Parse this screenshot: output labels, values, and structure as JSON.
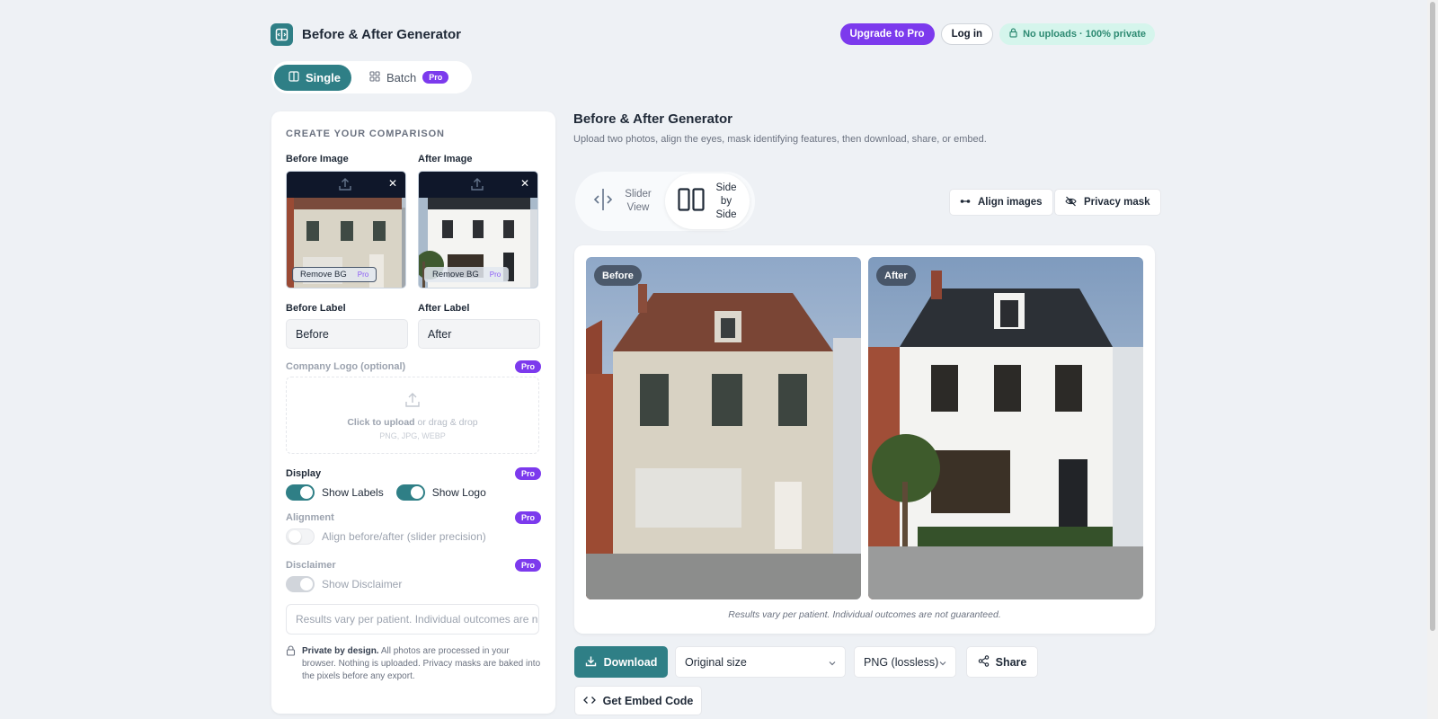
{
  "header": {
    "title": "Before & After Generator",
    "upgrade_label": "Upgrade to Pro",
    "login_label": "Log in",
    "privacy_pill": "No uploads · 100% private"
  },
  "mode_tabs": [
    {
      "label": "Single",
      "active": true
    },
    {
      "label": "Batch",
      "badge": "Pro"
    }
  ],
  "form": {
    "section_title": "CREATE YOUR COMPARISON",
    "before_image_label": "Before Image",
    "after_image_label": "After Image",
    "remove_bg_label": "Remove BG",
    "pro_badge": "Pro",
    "before_label_title": "Before Label",
    "after_label_title": "After Label",
    "before_label_value": "Before",
    "after_label_value": "After",
    "logo_title": "Company Logo (optional)",
    "upload_click": "Click to upload",
    "upload_rest": " or drag & drop",
    "upload_formats": "PNG, JPG, WEBP",
    "display_title": "Display",
    "show_labels": "Show Labels",
    "show_logo": "Show Logo",
    "show_labels_on": true,
    "show_logo_on": true,
    "alignment_title": "Alignment",
    "align_option": "Align before/after (slider precision)",
    "align_on": false,
    "disclaimer_title": "Disclaimer",
    "show_disclaimer": "Show Disclaimer",
    "disclaimer_value": "Results vary per patient. Individual outcomes are not guaranteed.",
    "private_bold": "Private by design.",
    "private_rest": " All photos are processed in your browser. Nothing is uploaded. Privacy masks are baked into the pixels before any export."
  },
  "main": {
    "title": "Before & After Generator",
    "subtitle": "Upload two photos, align the eyes, mask identifying features, then download, share, or embed.",
    "view_slider": "Slider View",
    "view_side": "Side by Side",
    "active_view": "Side by Side",
    "align_images": "Align images",
    "privacy_mask": "Privacy mask",
    "before_tag": "Before",
    "after_tag": "After",
    "preview_disclaimer": "Results vary per patient. Individual outcomes are not guaranteed."
  },
  "export": {
    "download_label": "Download",
    "size_select": "Original size",
    "format_select": "PNG (lossless)",
    "share_label": "Share",
    "embed_label": "Get Embed Code"
  },
  "colors": {
    "accent": "#2f7f86",
    "pro": "#7c3aed",
    "background": "#eef1f5"
  }
}
